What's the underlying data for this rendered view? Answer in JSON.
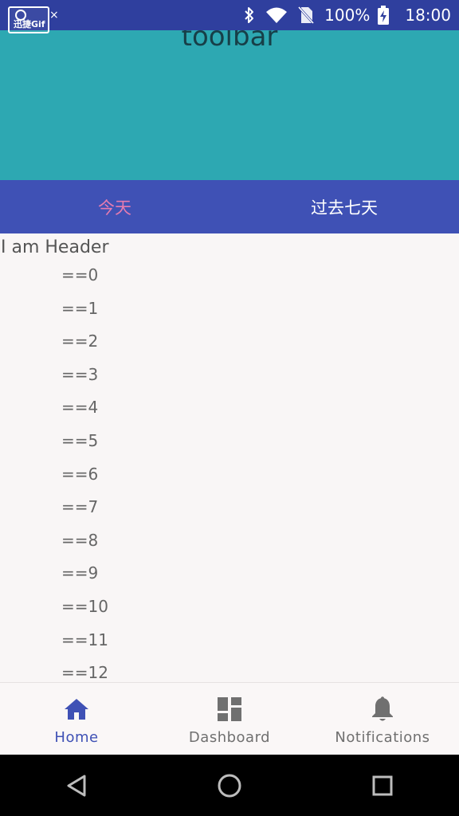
{
  "status_bar": {
    "gif_badge_label": "迅捷Gif",
    "gif_close_glyph": "×",
    "icons": [
      "bluetooth-icon",
      "wifi-icon",
      "no-sim-icon",
      "battery-charging-icon"
    ],
    "battery": "100%",
    "time": "18:00"
  },
  "toolbar": {
    "title": "toolbar",
    "background": "#2da8b2"
  },
  "tabs": [
    {
      "label": "今天",
      "selected": true
    },
    {
      "label": "过去七天",
      "selected": false
    }
  ],
  "list": {
    "header": "I am Header",
    "items": [
      "==0",
      "==1",
      "==2",
      "==3",
      "==4",
      "==5",
      "==6",
      "==7",
      "==8",
      "==9",
      "==10",
      "==11",
      "==12"
    ]
  },
  "bottom_nav": {
    "items": [
      {
        "label": "Home",
        "icon": "home-icon",
        "active": true
      },
      {
        "label": "Dashboard",
        "icon": "dashboard-icon",
        "active": false
      },
      {
        "label": "Notifications",
        "icon": "bell-icon",
        "active": false
      }
    ]
  },
  "system_nav": {
    "buttons": [
      "back-icon",
      "home-circle-icon",
      "recents-icon"
    ]
  },
  "colors": {
    "status_bar": "#2f3f9e",
    "tab_bar": "#3f51b5",
    "tab_selected": "#e57bb0",
    "nav_active": "#3f51b5",
    "nav_inactive": "#707070"
  }
}
